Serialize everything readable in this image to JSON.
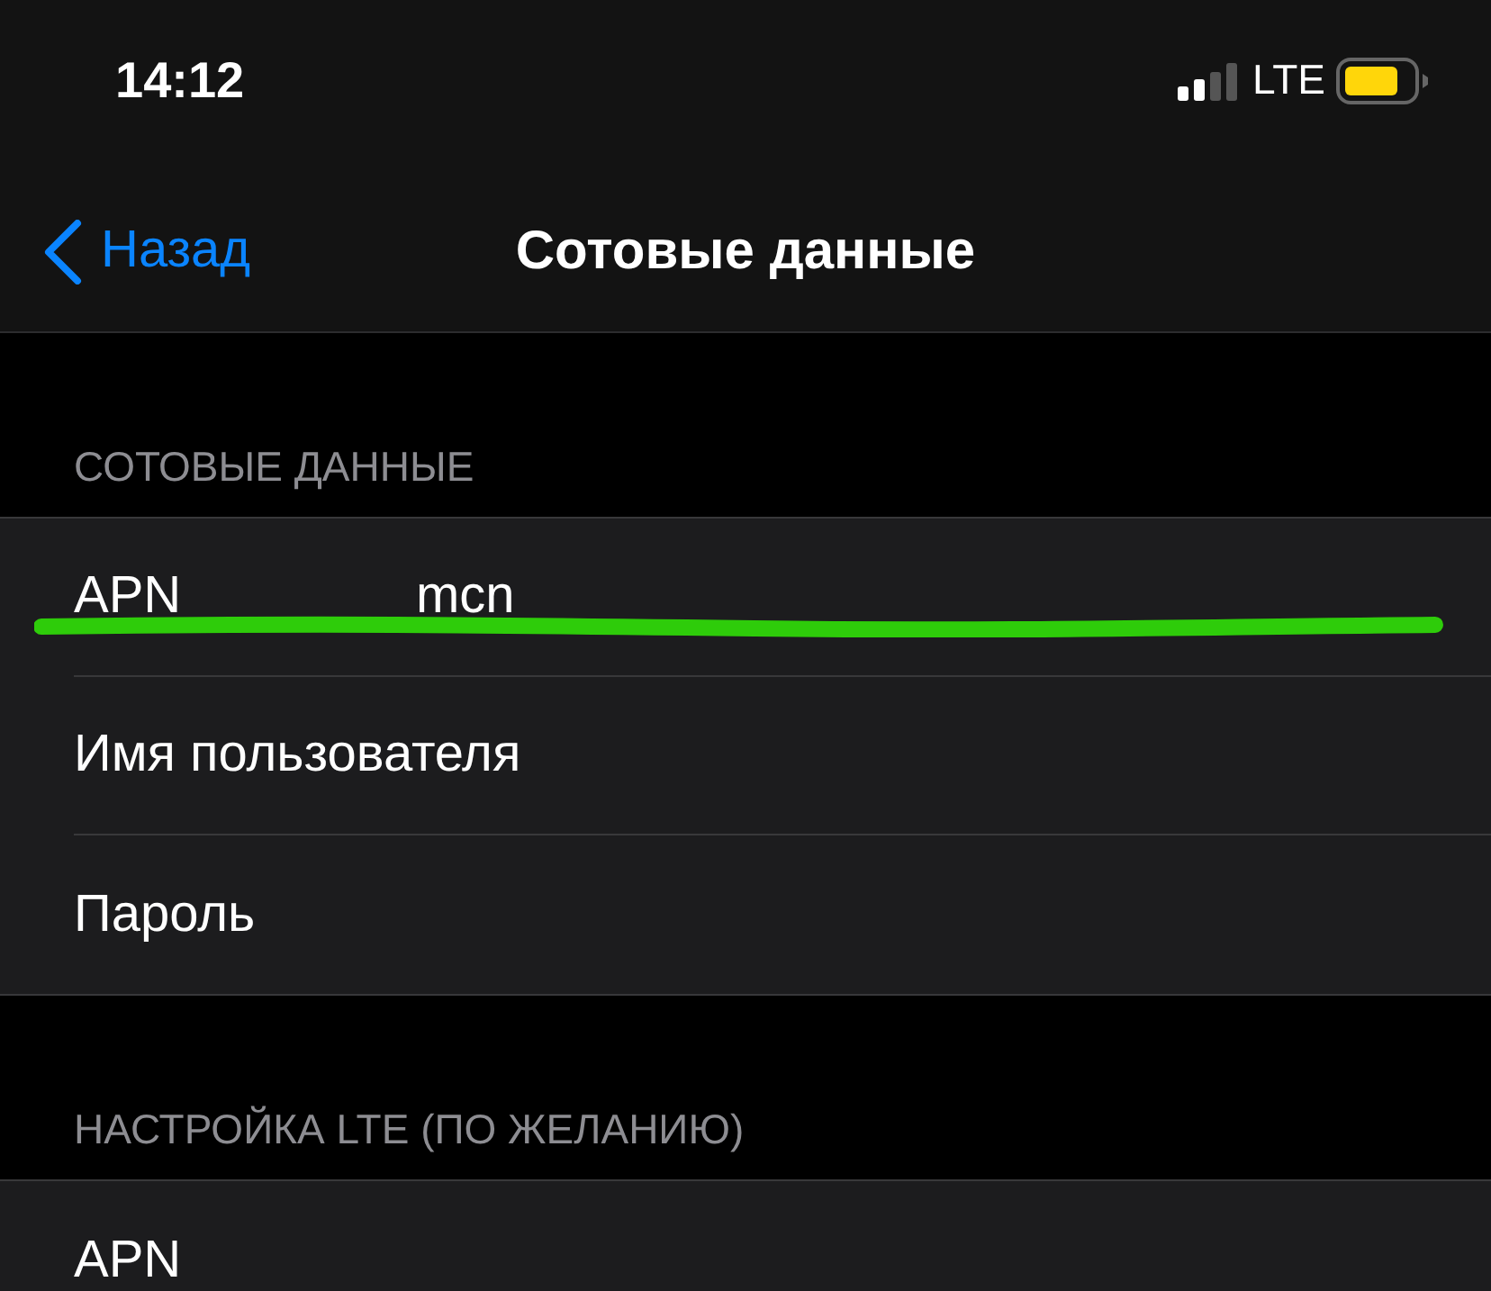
{
  "status_bar": {
    "time": "14:12",
    "network": "LTE"
  },
  "nav": {
    "back": "Назад",
    "title": "Сотовые данные"
  },
  "sections": [
    {
      "header": "СОТОВЫЕ ДАННЫЕ",
      "rows": [
        {
          "label": "APN",
          "value": "mcn",
          "underlined": true
        },
        {
          "label": "Имя пользователя"
        },
        {
          "label": "Пароль"
        }
      ]
    },
    {
      "header": "НАСТРОЙКА LTE (ПО ЖЕЛАНИЮ)",
      "rows": [
        {
          "label": "APN"
        }
      ]
    }
  ]
}
